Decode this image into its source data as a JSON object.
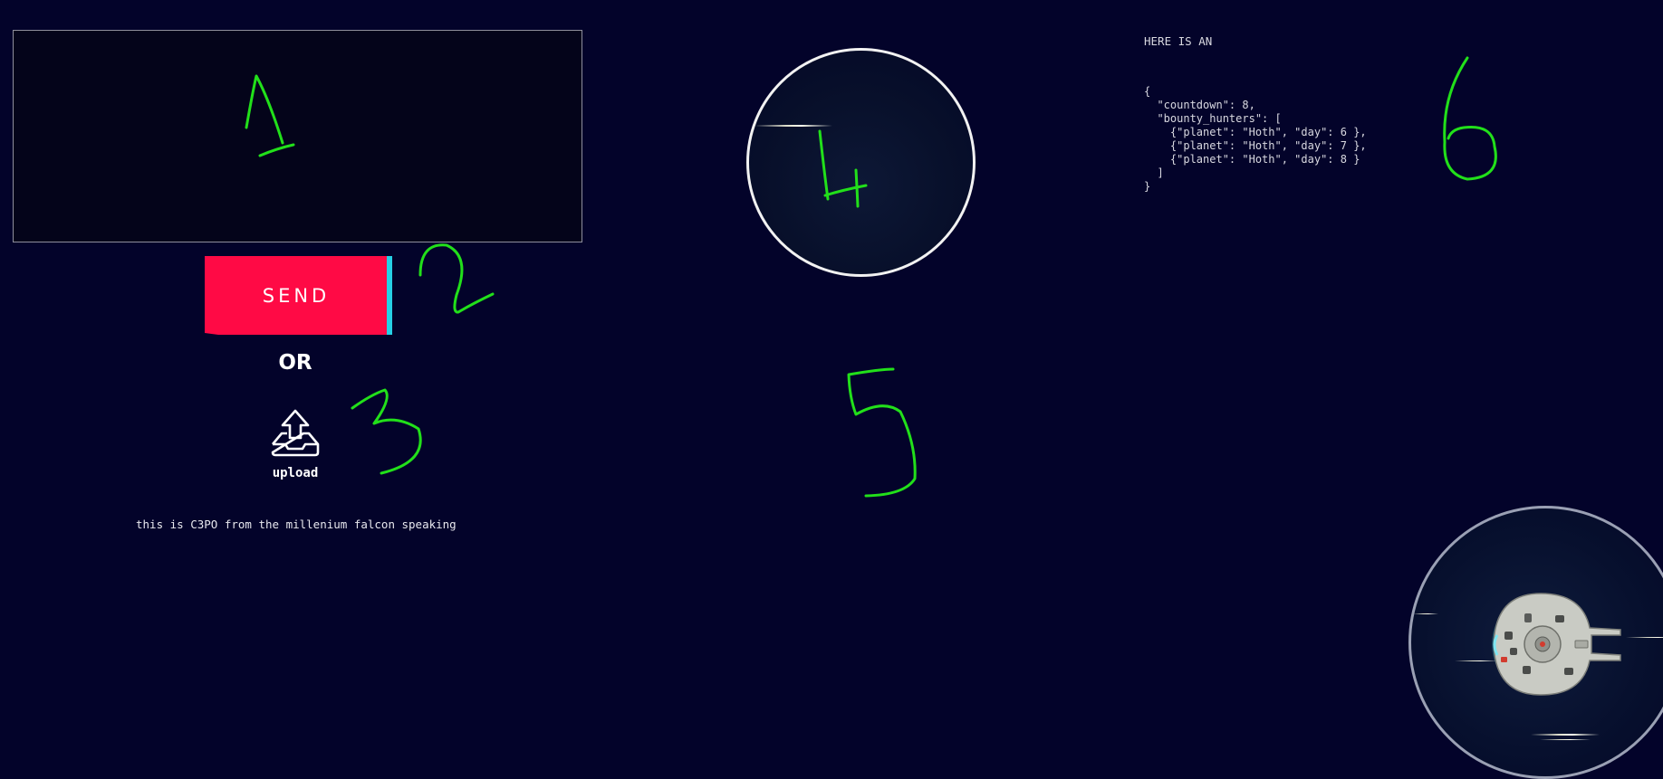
{
  "message_box": {
    "value": "",
    "placeholder": ""
  },
  "send_button": {
    "label": "SEND"
  },
  "or_label": "OR",
  "upload": {
    "label": "upload",
    "icon": "upload-tray-icon"
  },
  "status_line": "this is C3PO from the millenium falcon speaking",
  "json_panel": {
    "heading": "HERE IS AN",
    "code": "{\n  \"countdown\": 8,\n  \"bounty_hunters\": [\n    {\"planet\": \"Hoth\", \"day\": 6 },\n    {\"planet\": \"Hoth\", \"day\": 7 },\n    {\"planet\": \"Hoth\", \"day\": 8 }\n  ]\n}"
  },
  "annotations": [
    "1",
    "2",
    "3",
    "4",
    "5",
    "6"
  ],
  "colors": {
    "background": "#03032a",
    "send_button": "#ff0a45",
    "send_accent": "#26d0e6",
    "annotation": "#22e01a"
  }
}
